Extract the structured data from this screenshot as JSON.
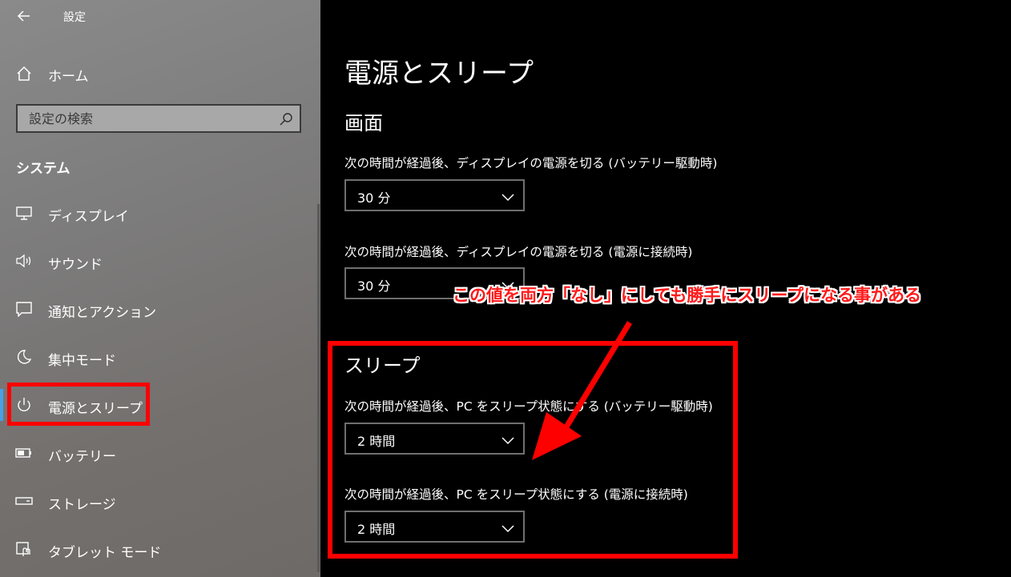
{
  "app": {
    "title": "設定"
  },
  "sidebar": {
    "home_label": "ホーム",
    "search_placeholder": "設定の検索",
    "section_label": "システム",
    "items": [
      {
        "label": "ディスプレイ",
        "icon": "monitor-icon"
      },
      {
        "label": "サウンド",
        "icon": "speaker-icon"
      },
      {
        "label": "通知とアクション",
        "icon": "notification-icon"
      },
      {
        "label": "集中モード",
        "icon": "moon-icon"
      },
      {
        "label": "電源とスリープ",
        "icon": "power-icon",
        "selected": true
      },
      {
        "label": "バッテリー",
        "icon": "battery-icon"
      },
      {
        "label": "ストレージ",
        "icon": "storage-icon"
      },
      {
        "label": "タブレット モード",
        "icon": "tablet-mode-icon"
      }
    ]
  },
  "main": {
    "page_title": "電源とスリープ",
    "screen": {
      "heading": "画面",
      "battery_label": "次の時間が経過後、ディスプレイの電源を切る (バッテリー駆動時)",
      "battery_value": "30 分",
      "plugged_label": "次の時間が経過後、ディスプレイの電源を切る (電源に接続時)",
      "plugged_value": "30 分"
    },
    "sleep": {
      "heading": "スリープ",
      "battery_label": "次の時間が経過後、PC をスリープ状態にする (バッテリー駆動時)",
      "battery_value": "2 時間",
      "plugged_label": "次の時間が経過後、PC をスリープ状態にする (電源に接続時)",
      "plugged_value": "2 時間"
    }
  },
  "annotation": {
    "text": "この値を両方「なし」にしても勝手にスリープになる事がある",
    "color": "#ff0000"
  },
  "colors": {
    "accent": "#4aa0e6",
    "highlight": "#ff0000"
  }
}
